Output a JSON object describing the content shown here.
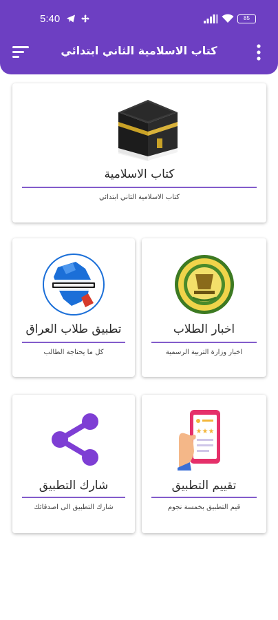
{
  "status_bar": {
    "time": "5:40",
    "battery": "85",
    "icons": [
      "telegram-icon",
      "fan-icon",
      "signal-bars-icon",
      "wifi-icon",
      "battery-icon"
    ]
  },
  "toolbar": {
    "title": "كتاب الاسلامية الثاني ابتدائي",
    "menu_icon": "sort-menu-icon",
    "more_icon": "more-vert-icon"
  },
  "theme": {
    "accent": "#6d3fc2"
  },
  "cards": {
    "book": {
      "title": "كتاب الاسلامية",
      "subtitle": "كتاب الاسلامية الثاني ابتدائي",
      "icon": "kaaba-icon"
    },
    "iraq_students": {
      "title": "تطبيق طلاب العراق",
      "subtitle": "كل ما يحتاجة الطالب",
      "icon": "iraq-map-icon"
    },
    "news": {
      "title": "اخبار الطلاب",
      "subtitle": "اخبار وزارة التربية الرسمية",
      "icon": "ministry-emblem-icon"
    },
    "share": {
      "title": "شارك التطبيق",
      "subtitle": "شارك التطبيق الى اصدقائك",
      "icon": "share-icon"
    },
    "rate": {
      "title": "تقييم التطبيق",
      "subtitle": "قيم التطبيق بخمسة نجوم",
      "icon": "rate-phone-icon"
    }
  }
}
